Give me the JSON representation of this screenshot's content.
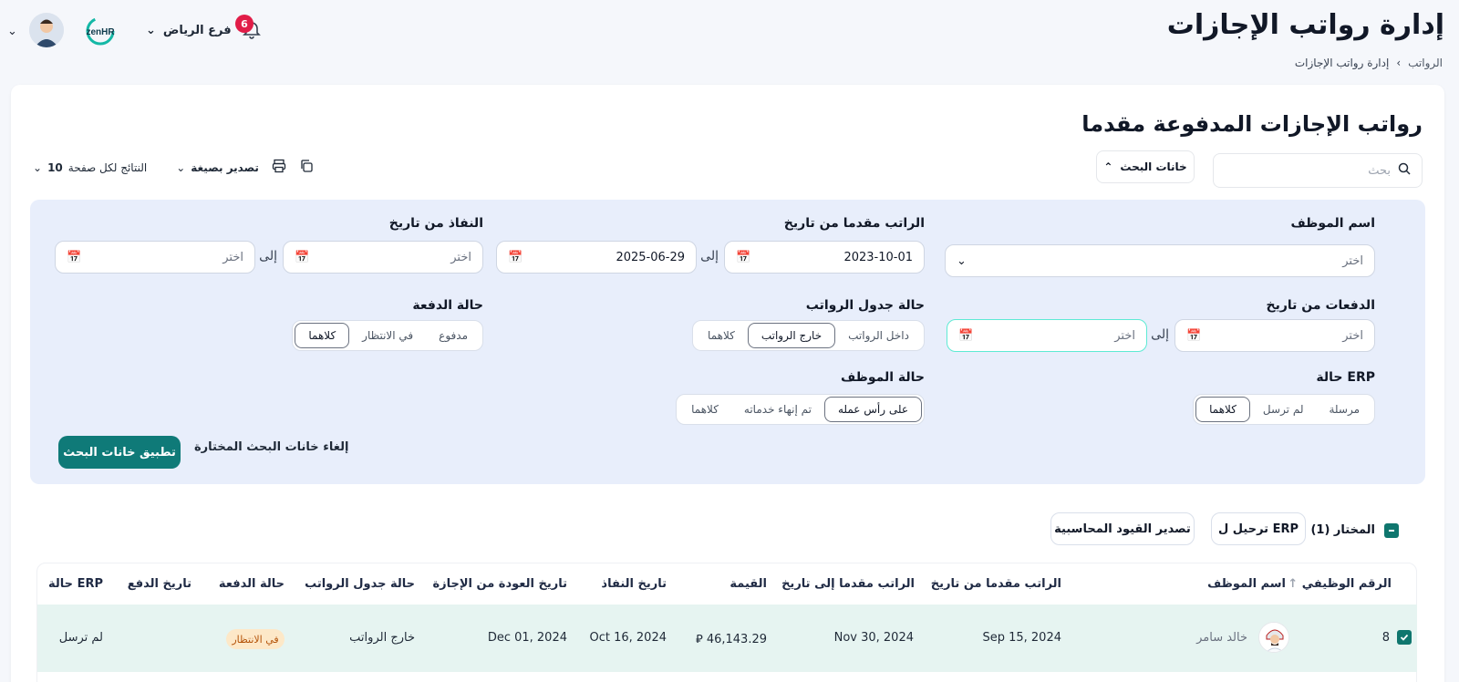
{
  "header": {
    "title": "إدارة رواتب الإجازات",
    "breadcrumb": [
      "الرواتب",
      "إدارة رواتب الإجازات"
    ],
    "notifications_count": "6",
    "branch": "فرع الرياض",
    "logo_text": "zenHR"
  },
  "card": {
    "title": "رواتب الإجازات المدفوعة مقدما",
    "search_placeholder": "بحث",
    "filters_button": "خانات البحث",
    "per_page_label": "النتائج لكل صفحة",
    "per_page_value": "10",
    "export_label": "تصدير بصيغة"
  },
  "filters": {
    "employee_name": {
      "label": "اسم الموظف",
      "placeholder": "اختر"
    },
    "advance_from": {
      "label": "الراتب مقدما من تاريخ",
      "from": "2023-10-01",
      "to": "2025-06-29"
    },
    "effective_from": {
      "label": "النفاذ من تاريخ",
      "from": "اختر",
      "to": "اختر"
    },
    "payments_from": {
      "label": "الدفعات من تاريخ",
      "from": "اختر",
      "to": "اختر"
    },
    "to_word": "إلى",
    "payroll_status": {
      "label": "حالة جدول الرواتب",
      "options": [
        "داخل الرواتب",
        "خارج الرواتب",
        "كلاهما"
      ],
      "selected": "خارج الرواتب"
    },
    "payment_status": {
      "label": "حالة الدفعة",
      "options": [
        "مدفوع",
        "في الانتظار",
        "كلاهما"
      ],
      "selected": "كلاهما"
    },
    "erp_status": {
      "label": "حالة ERP",
      "options": [
        "مرسلة",
        "لم ترسل",
        "كلاهما"
      ],
      "selected": "كلاهما"
    },
    "employee_status": {
      "label": "حالة الموظف",
      "options": [
        "على رأس عمله",
        "تم إنهاء خدماته",
        "كلاهما"
      ],
      "selected": "على رأس عمله"
    },
    "apply_button": "تطبيق خانات البحث",
    "clear_button": "إلغاء خانات البحث المختارة"
  },
  "selection": {
    "label": "المختار (1)",
    "erp_button": "ترحيل ل ERP",
    "export_entries_button": "تصدير القيود المحاسبية"
  },
  "table": {
    "columns": [
      "الرقم الوظيفي",
      "اسم الموظف",
      "الراتب مقدما من تاريخ",
      "الراتب مقدما إلى تاريخ",
      "القيمة",
      "تاريخ النفاذ",
      "تاريخ العودة من الإجازة",
      "حالة جدول الرواتب",
      "حالة الدفعة",
      "تاريخ الدفع",
      "حالة ERP"
    ],
    "rows": [
      {
        "id": "8",
        "name": "خالد سامر",
        "from": "Sep 15, 2024",
        "to": "Nov 30, 2024",
        "amount": "46,143.29",
        "currency_symbol": "⃁",
        "effective": "Oct 16, 2024",
        "return": "Dec 01, 2024",
        "payroll": "خارج الرواتب",
        "payment": "في الانتظار",
        "pay_date": "",
        "erp": "لم ترسل"
      }
    ]
  },
  "colors": {
    "accent": "#0f7a78",
    "panel": "#e8eefb",
    "row_selected": "#e6f4f1",
    "badge": "#e11d48"
  }
}
